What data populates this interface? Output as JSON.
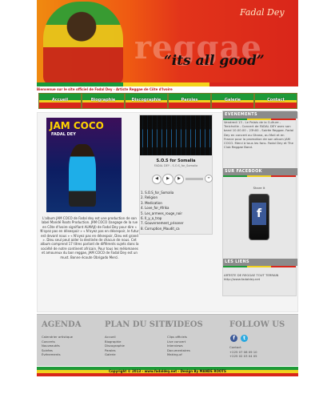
{
  "banner": {
    "brand": "Fadal Dey",
    "slogan": "“its all good”",
    "background_word": "reggae",
    "marquee": "Bienvenue sur le site officiel de Fadal Dey - Artiste Reggae de Côte d'Ivoire"
  },
  "nav": {
    "items": [
      {
        "label": "Accueil"
      },
      {
        "label": "Biographie"
      },
      {
        "label": "Discographie"
      },
      {
        "label": "Paroles"
      },
      {
        "label": "Galerie"
      },
      {
        "label": "Contact"
      }
    ]
  },
  "album": {
    "title": "JAM COCO",
    "artist": "FADAL DEY",
    "description": "L'album JAM COCO de Fadal dey est une production de son label Mandé Roots Production. JAM COCO (langage de la rue en Côte d'Ivoire signifiant ALMAJI) de Fadal Dey pour dire « N'oyez pas en désespoir » « N'oyez pas en désespoir, le futur est devant nous » « N'oyez pas en désespoir, Dieu est grand ». Dieu seul peut aider la destinée de chacun de nous. Cet album comprend 17 titres parlant de différents sujets dans la société de notre continent africain. Pour tous les mélomanes et amoureux du bon reggae, JAM COCO de Fadal Dey est un must. Bonne écoute Obrigado Merci."
  },
  "player": {
    "track_title": "S.O.S for Somalia",
    "track_sub": "FADAL DEY - S.O.S_for_Somalia",
    "progress": 0.0,
    "controls": [
      "prev",
      "play",
      "next",
      "volume",
      "menu"
    ],
    "playlist": [
      "1. S.O.S_for_Somalia",
      "2. Religion",
      "3. Medication",
      "4. Love_for_Afrika",
      "5. Les_armees_rouge_noir",
      "6. Il_y_a_trop",
      "7. Gouvernement_prisoner",
      "8. Corruption_Maudit_ca"
    ]
  },
  "sidebar": {
    "events_heading": "EVENEMENTS",
    "events_text": "Vendredi 13 - Le Palais de la Culture - Treichville - Concert de FADAL DEY avec son band 10.00.00 - 23h00 - Soirée Reggae. Fadal Dey en concert au Ghana, au Mali et en France pour la promotion de son album JAM COCO. Merci à tous les fans. Fadal Dey et The Club Reggae Band.",
    "facebook_heading": "SUR FACEBOOK",
    "facebook_title": "Share It",
    "links_heading": "LES LIENS",
    "links_text": "ARTISTE DE REGGAE TOUT TERRAIN http://www.fadaldey.net"
  },
  "footer": {
    "agenda": {
      "title": "AGENDA",
      "items": [
        "Calendrier artistique",
        "Concerts",
        "Nouveautés",
        "Soirées",
        "Événements"
      ]
    },
    "plan": {
      "title": "PLAN DU SITE",
      "items": [
        "Accueil",
        "Biographie",
        "Discographie",
        "Paroles",
        "Galerie"
      ]
    },
    "videos": {
      "title": "VIDEOS",
      "items": [
        "Clips officiels",
        "Live concert",
        "Interviews",
        "Documentaires",
        "Making-of"
      ]
    },
    "follow": {
      "title": "FOLLOW US",
      "items": [
        "Contact",
        "+225 07 08 09 10",
        "+225 02 03 04 05"
      ]
    },
    "copyright": "Copyright © 2013 - www.fadaldey.net - Design By MANDE ROOTS"
  },
  "colors": {
    "green": "#1e9a38",
    "yellow": "#f1d11e",
    "red": "#d8261b",
    "facebook": "#3b5998",
    "twitter": "#2aa9e0"
  }
}
